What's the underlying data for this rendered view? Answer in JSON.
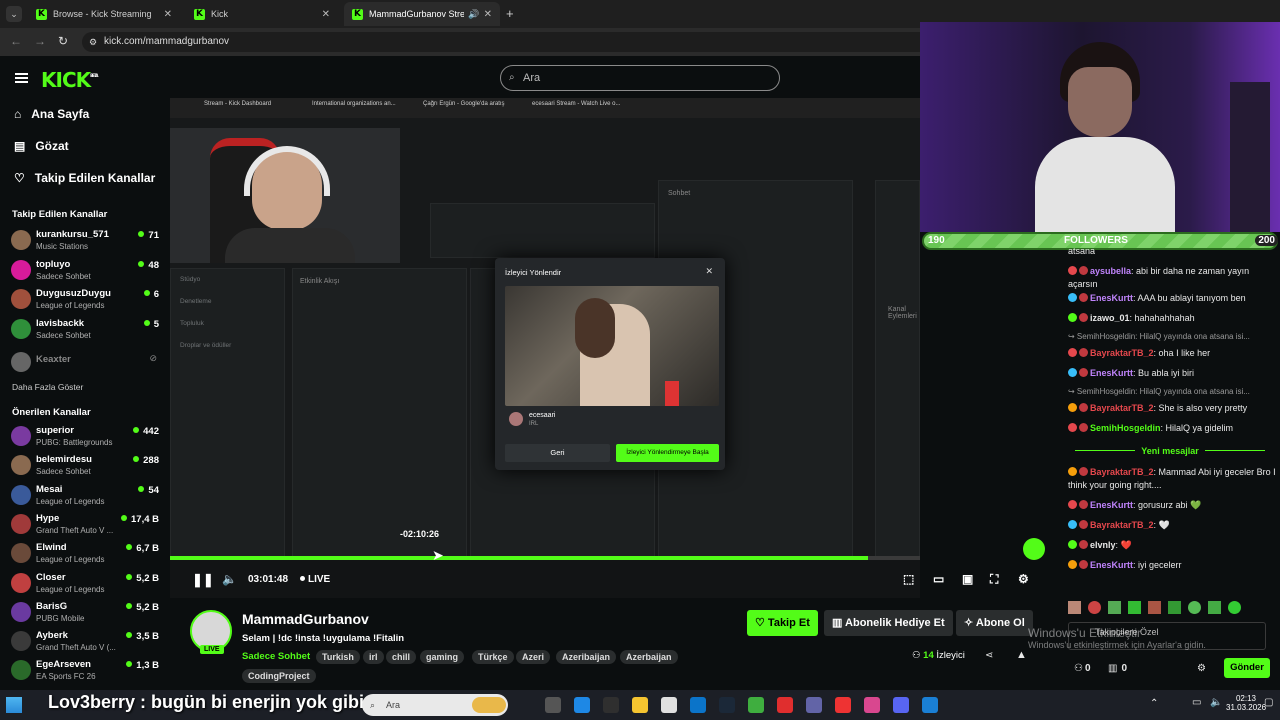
{
  "browser": {
    "tabs": [
      {
        "label": "Browse - Kick Streaming",
        "active": false
      },
      {
        "label": "Kick",
        "active": false
      },
      {
        "label": "MammadGurbanov Stream",
        "active": true
      }
    ],
    "url": "kick.com/mammadgurbanov"
  },
  "header": {
    "logo": "KICK",
    "logo_sup": "BETA",
    "search_placeholder": "Ara"
  },
  "sidebar": {
    "nav": [
      {
        "label": "Ana Sayfa",
        "icon": "home-icon"
      },
      {
        "label": "Gözat",
        "icon": "browse-icon"
      },
      {
        "label": "Takip Edilen Kanallar",
        "icon": "heart-icon"
      }
    ],
    "followed_title": "Takip Edilen Kanallar",
    "followed": [
      {
        "name": "kurankursu_571",
        "category": "Music Stations",
        "viewers": "71",
        "color": "#8a6a50"
      },
      {
        "name": "topluyo",
        "category": "Sadece Sohbet",
        "viewers": "48",
        "color": "#d81b9a"
      },
      {
        "name": "DuygusuzDuygu",
        "category": "League of Legends",
        "viewers": "6",
        "color": "#a0503c"
      },
      {
        "name": "lavisbackk",
        "category": "Sadece Sohbet",
        "viewers": "5",
        "color": "#2f8f3a"
      }
    ],
    "offline": "Keaxter",
    "show_more": "Daha Fazla Göster",
    "recommended_title": "Önerilen Kanallar",
    "recommended": [
      {
        "name": "superior",
        "category": "PUBG: Battlegrounds",
        "viewers": "442",
        "color": "#7a3aa0"
      },
      {
        "name": "belemirdesu",
        "category": "Sadece Sohbet",
        "viewers": "288",
        "color": "#8a6a50"
      },
      {
        "name": "Mesai",
        "category": "League of Legends",
        "viewers": "54",
        "color": "#3a5a9a"
      },
      {
        "name": "Hype",
        "category": "Grand Theft Auto V ...",
        "viewers": "17,4 B",
        "color": "#a03a3a"
      },
      {
        "name": "Elwind",
        "category": "League of Legends",
        "viewers": "6,7 B",
        "color": "#6a4a3a"
      },
      {
        "name": "Closer",
        "category": "League of Legends",
        "viewers": "5,2 B",
        "color": "#c04040"
      },
      {
        "name": "BarisG",
        "category": "PUBG Mobile",
        "viewers": "5,2 B",
        "color": "#6a3aa0"
      },
      {
        "name": "Ayberk",
        "category": "Grand Theft Auto V (...",
        "viewers": "3,5 B",
        "color": "#3a3a3a"
      },
      {
        "name": "EgeArseven",
        "category": "EA Sports FC 26",
        "viewers": "1,3 B",
        "color": "#2a6a2a"
      }
    ]
  },
  "video": {
    "inner_tabs": [
      "Stream - Kick Dashboard",
      "International organizations an...",
      "Çağrı Ergün - Google'da aratış",
      "ecesaari Stream - Watch Live o..."
    ],
    "modal": {
      "title": "İzleyici Yönlendir",
      "streamer": "ecesaari",
      "category": "IRL",
      "back": "Geri",
      "start": "İzleyici Yönlendirmeye Başla"
    },
    "seek_tooltip": "-02:10:26",
    "progress": 0.93,
    "time": "03:01:48",
    "live": "LIVE"
  },
  "overlay": {
    "followers_label": "FOLLOWERS",
    "current": "190",
    "goal": "200"
  },
  "chat": {
    "messages": [
      {
        "type": "msg",
        "user": "",
        "color": "#e8e8e8",
        "text": "atsana"
      },
      {
        "type": "msg",
        "user": "aysubella",
        "color": "#c084fc",
        "text": ": abi bir daha ne zaman yayın açarsın"
      },
      {
        "type": "msg",
        "user": "EnesKurtt",
        "color": "#c084fc",
        "text": ": AAA bu ablayi tanıyom ben"
      },
      {
        "type": "msg",
        "user": "izawo_01",
        "color": "#e8e8e8",
        "text": ": hahahahhahah"
      },
      {
        "type": "reply",
        "text": "SemihHosgeldin: HilalQ yayında ona atsana isi..."
      },
      {
        "type": "msg",
        "user": "BayraktarTB_2",
        "color": "#e5484d",
        "text": ": oha I like her"
      },
      {
        "type": "msg",
        "user": "EnesKurtt",
        "color": "#c084fc",
        "text": ": Bu abla iyi biri"
      },
      {
        "type": "reply",
        "text": "SemihHosgeldin: HilalQ yayında ona atsana isi..."
      },
      {
        "type": "msg",
        "user": "BayraktarTB_2",
        "color": "#e5484d",
        "text": ": She is also very pretty"
      },
      {
        "type": "msg",
        "user": "SemihHosgeldin",
        "color": "#53fc18",
        "text": ": HilalQ ya gidelim"
      }
    ],
    "new_label": "Yeni mesajlar",
    "new_messages": [
      {
        "user": "BayraktarTB_2",
        "color": "#e5484d",
        "text": ": Mammad Abi iyi geceler Bro I think your going right...."
      },
      {
        "user": "EnesKurtt",
        "color": "#c084fc",
        "text": ": gorusurz abi 💚"
      },
      {
        "user": "BayraktarTB_2",
        "color": "#e5484d",
        "text": ": 🤍"
      },
      {
        "user": "elvnly",
        "color": "#e8e8e8",
        "text": ": ❤️"
      },
      {
        "user": "EnesKurtt",
        "color": "#c084fc",
        "text": ": iyi gecelerr"
      }
    ],
    "input_placeholder": "Takipçilere Özel",
    "send": "Gönder",
    "count_a": "0",
    "count_b": "0"
  },
  "info": {
    "channel": "MammadGurbanov",
    "live_badge": "LIVE",
    "title": "Selam | !dc !insta !uygulama  !Fitalin",
    "category": "Sadece Sohbet",
    "tags": [
      "Turkish",
      "irl",
      "chill",
      "gaming",
      "Türkçe",
      "Azeri",
      "Azeribaijan",
      "Azerbaijan",
      "CodingProject"
    ],
    "follow": "Takip Et",
    "gift": "Abonelik Hediye Et",
    "subscribe": "Abone Ol",
    "viewers_count": "14",
    "viewers_label": "İzleyici"
  },
  "watermark": {
    "line1": "Windows'u Etkinleştir",
    "line2": "Windows'u etkinleştirmek için Ayarlar'a gidin."
  },
  "taskbar": {
    "overlay_text": "Lov3berry : bugün bi enerjin yok gibi",
    "search": "Ara",
    "time": "02:13",
    "date": "31.03.2026"
  },
  "colors": {
    "accent": "#53fc18",
    "bg": "#0b0e0f"
  }
}
